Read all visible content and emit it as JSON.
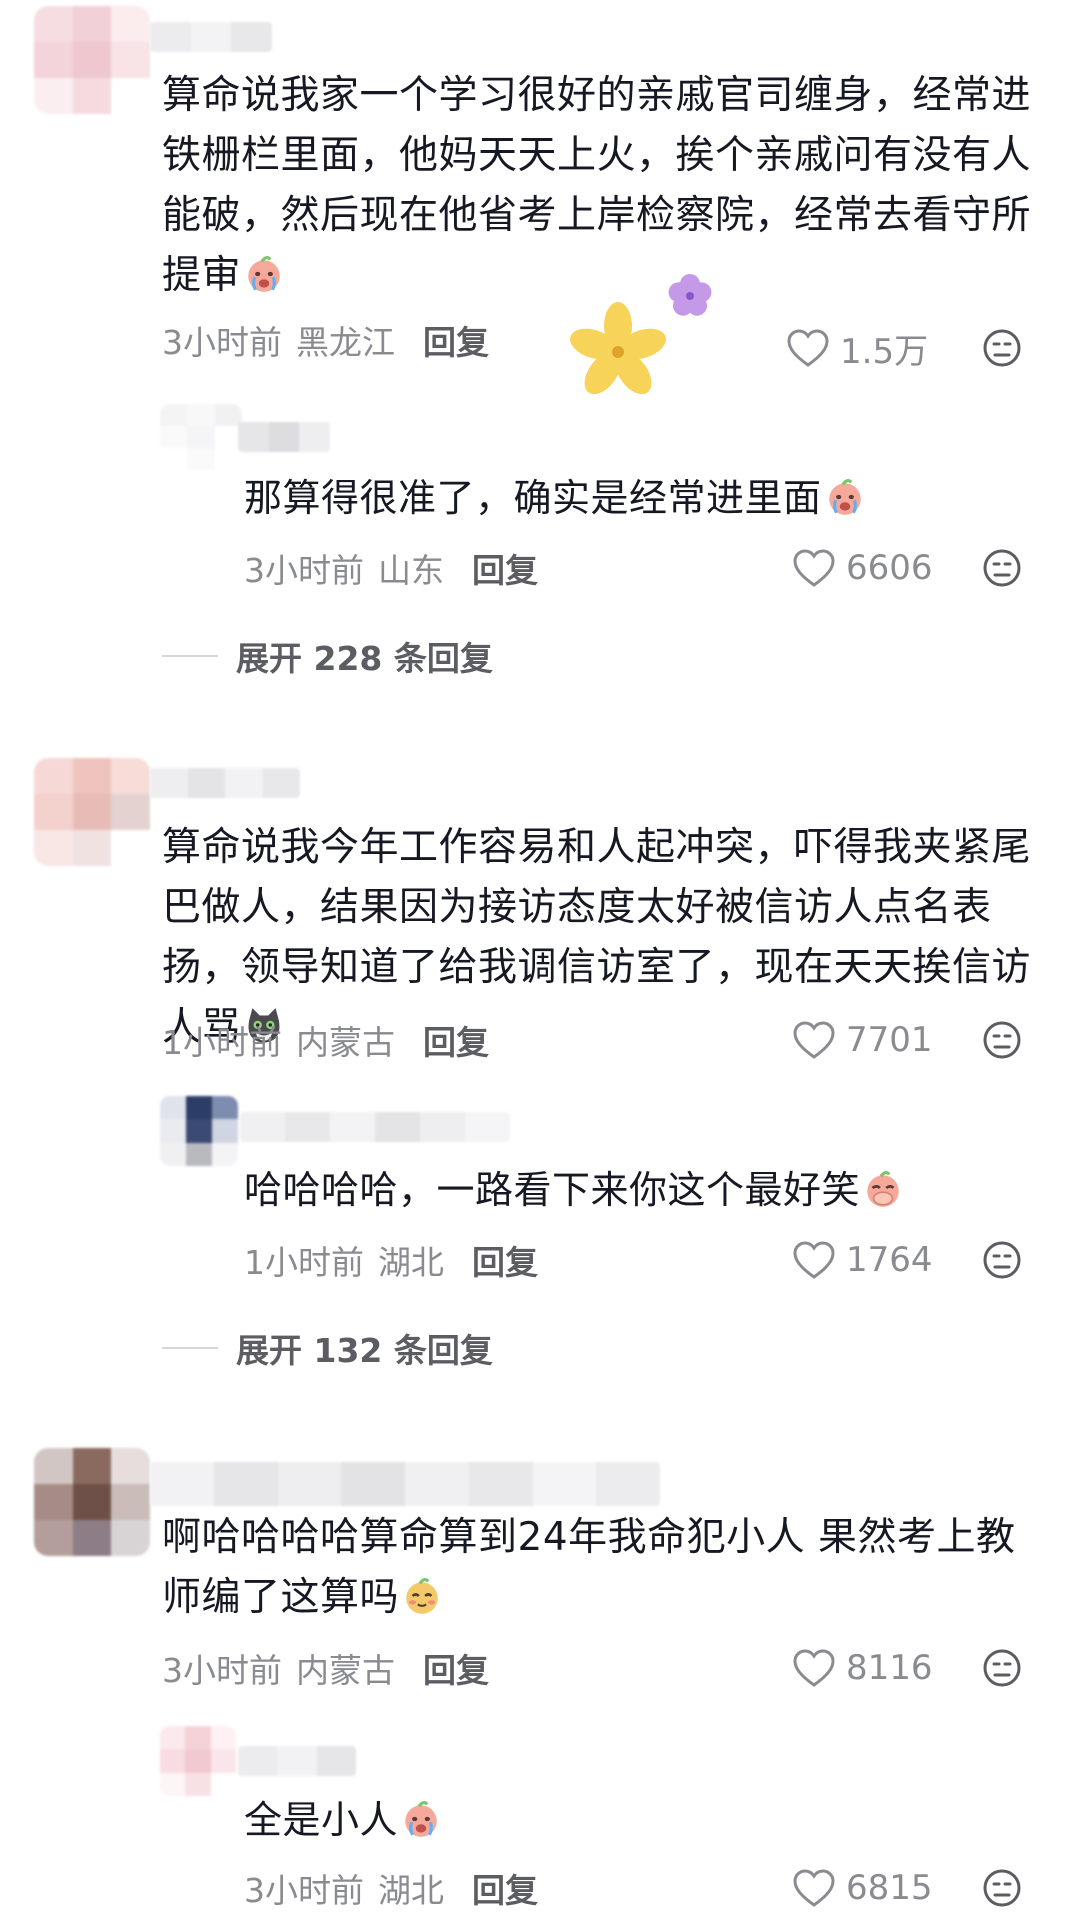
{
  "comments": [
    {
      "text": "算命说我家一个学习很好的亲戚官司缠身，经常进铁栅栏里面，他妈天天上火，挨个亲戚问有没有人能破，然后现在他省考上岸检察院，经常去看守所提审",
      "time": "3小时前",
      "location": "黑龙江",
      "reply_label": "回复",
      "likes": "1.5万",
      "emoji": "crying-face-emoji",
      "reply": {
        "text": "那算得很准了，确实是经常进里面",
        "time": "3小时前",
        "location": "山东",
        "reply_label": "回复",
        "likes": "6606",
        "emoji": "crying-face-emoji"
      },
      "expand_label": "展开 228 条回复"
    },
    {
      "text": "算命说我今年工作容易和人起冲突，吓得我夹紧尾巴做人，结果因为接访态度太好被信访人点名表扬，领导知道了给我调信访室了，现在天天挨信访人骂",
      "time": "1小时前",
      "location": "内蒙古",
      "reply_label": "回复",
      "likes": "7701",
      "emoji": "cat-emoji",
      "reply": {
        "text": "哈哈哈哈，一路看下来你这个最好笑",
        "time": "1小时前",
        "location": "湖北",
        "reply_label": "回复",
        "likes": "1764",
        "emoji": "covering-mouth-emoji"
      },
      "expand_label": "展开 132 条回复"
    },
    {
      "text": "啊哈哈哈哈算命算到24年我命犯小人 果然考上教师编了这算吗",
      "time": "3小时前",
      "location": "内蒙古",
      "reply_label": "回复",
      "likes": "8116",
      "emoji": "shy-face-emoji",
      "reply": {
        "text": "全是小人",
        "time": "3小时前",
        "location": "湖北",
        "reply_label": "回复",
        "likes": "6815",
        "emoji": "crying-face-emoji"
      }
    }
  ],
  "colors": {
    "text": "#161823",
    "meta": "#8a8b91",
    "reply_button": "#5c5d63",
    "flower_yellow": "#f7d35a",
    "flower_purple": "#c49ae8"
  }
}
